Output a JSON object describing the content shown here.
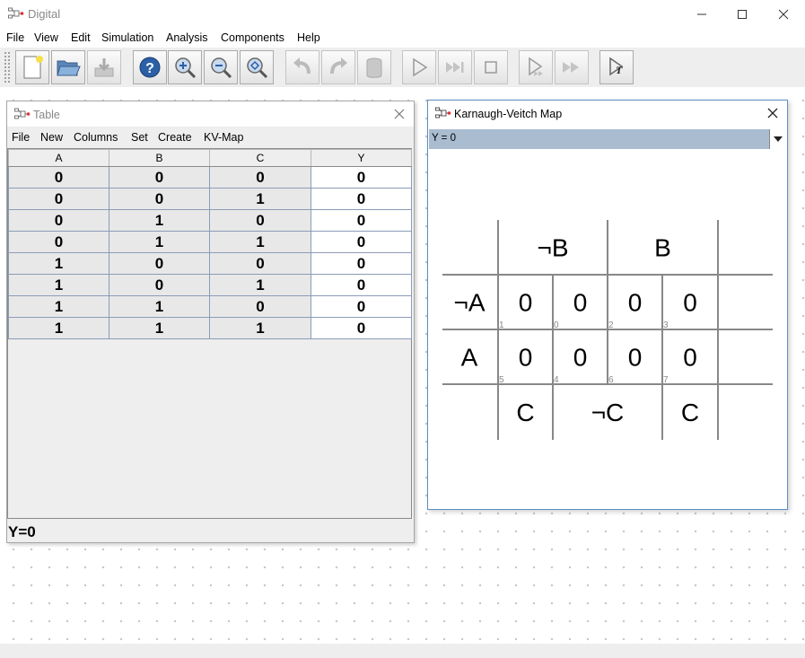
{
  "app": {
    "title": "Digital"
  },
  "menu": [
    "File",
    "View",
    "Edit",
    "Simulation",
    "Analysis",
    "Components",
    "Help"
  ],
  "table_window": {
    "title": "Table",
    "menu": [
      "File",
      "New",
      "Columns",
      "Set",
      "Create",
      "KV-Map"
    ],
    "columns": [
      "A",
      "B",
      "C",
      "Y"
    ],
    "rows": [
      [
        "0",
        "0",
        "0",
        "0"
      ],
      [
        "0",
        "0",
        "1",
        "0"
      ],
      [
        "0",
        "1",
        "0",
        "0"
      ],
      [
        "0",
        "1",
        "1",
        "0"
      ],
      [
        "1",
        "0",
        "0",
        "0"
      ],
      [
        "1",
        "0",
        "1",
        "0"
      ],
      [
        "1",
        "1",
        "0",
        "0"
      ],
      [
        "1",
        "1",
        "1",
        "0"
      ]
    ],
    "status": "Y=0"
  },
  "kv_window": {
    "title": "Karnaugh-Veitch Map",
    "selected_output": "Y = 0",
    "top_labels": [
      "¬B",
      "B"
    ],
    "row_labels": [
      "¬A",
      "A"
    ],
    "bottom_labels": [
      "C",
      "¬C",
      "C"
    ],
    "cells": [
      [
        {
          "v": "0",
          "i": "1"
        },
        {
          "v": "0",
          "i": "0"
        },
        {
          "v": "0",
          "i": "2"
        },
        {
          "v": "0",
          "i": "3"
        }
      ],
      [
        {
          "v": "0",
          "i": "5"
        },
        {
          "v": "0",
          "i": "4"
        },
        {
          "v": "0",
          "i": "6"
        },
        {
          "v": "0",
          "i": "7"
        }
      ]
    ]
  },
  "colors": {
    "accent": "#5a8fc4",
    "selection": "#a9bcd0"
  }
}
